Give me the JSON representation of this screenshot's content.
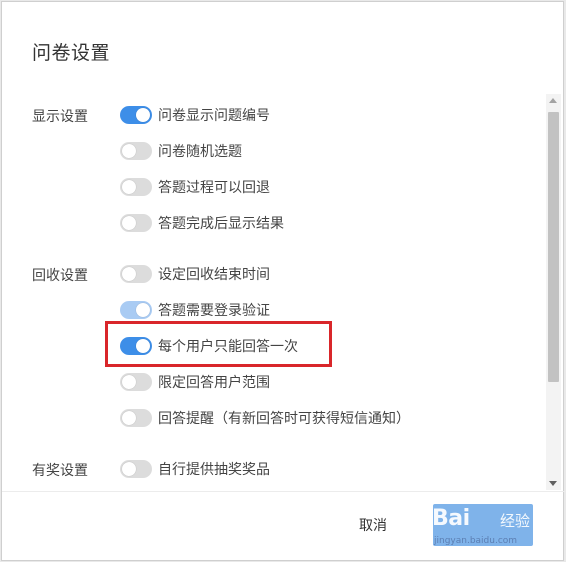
{
  "dialog": {
    "title": "问卷设置"
  },
  "colors": {
    "accent": "#3d8ee8",
    "highlight": "#d9262a",
    "toggle_off": "#dcdcdc"
  },
  "groups": [
    {
      "label": "显示设置",
      "items": [
        {
          "label": "问卷显示问题编号",
          "state": "on"
        },
        {
          "label": "问卷随机选题",
          "state": "off"
        },
        {
          "label": "答题过程可以回退",
          "state": "off"
        },
        {
          "label": "答题完成后显示结果",
          "state": "off"
        }
      ]
    },
    {
      "label": "回收设置",
      "items": [
        {
          "label": "设定回收结束时间",
          "state": "off"
        },
        {
          "label": "答题需要登录验证",
          "state": "on-disabled"
        },
        {
          "label": "每个用户只能回答一次",
          "state": "on"
        },
        {
          "label": "限定回答用户范围",
          "state": "off"
        },
        {
          "label": "回答提醒（有新回答时可获得短信通知）",
          "state": "off"
        }
      ]
    },
    {
      "label": "有奖设置",
      "items": [
        {
          "label": "自行提供抽奖奖品",
          "state": "off"
        }
      ]
    }
  ],
  "footer": {
    "cancel_label": "取消",
    "confirm_label": ""
  },
  "watermark": {
    "brand": "Bai",
    "brand_suffix": "经验",
    "url": "jingyan.baidu.com"
  }
}
